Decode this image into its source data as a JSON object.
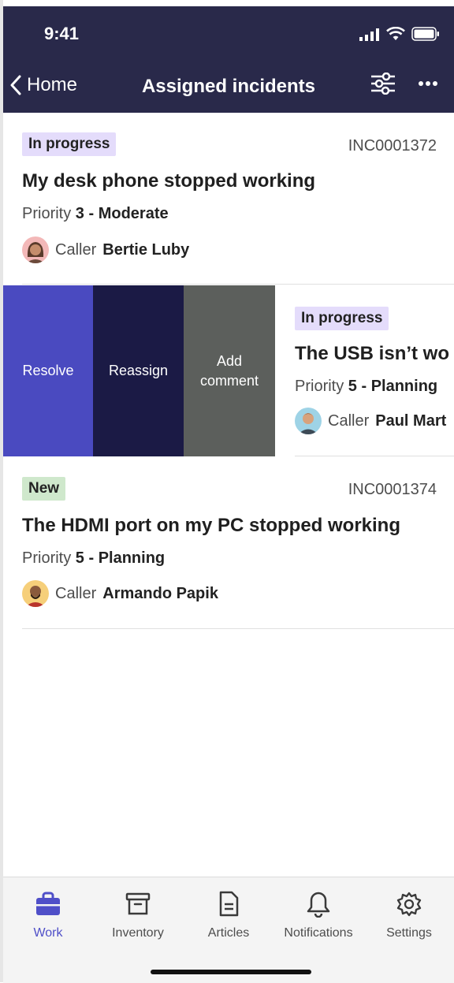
{
  "status_bar": {
    "time": "9:41"
  },
  "nav": {
    "back_label": "Home",
    "title": "Assigned incidents"
  },
  "incidents": [
    {
      "status": "In progress",
      "id": "INC0001372",
      "title": "My desk phone stopped working",
      "priority_label": "Priority",
      "priority_value": "3 - Moderate",
      "caller_label": "Caller",
      "caller_name": "Bertie Luby"
    },
    {
      "status": "In progress",
      "title": "The USB isn’t wo",
      "priority_label": "Priority",
      "priority_value": "5 - Planning",
      "caller_label": "Caller",
      "caller_name": "Paul Mart"
    },
    {
      "status": "New",
      "id": "INC0001374",
      "title": "The HDMI port on my PC stopped working",
      "priority_label": "Priority",
      "priority_value": "5 - Planning",
      "caller_label": "Caller",
      "caller_name": "Armando Papik"
    }
  ],
  "swipe_actions": {
    "resolve": "Resolve",
    "reassign": "Reassign",
    "add_comment_line1": "Add",
    "add_comment_line2": "comment"
  },
  "tabs": [
    {
      "label": "Work",
      "icon": "briefcase-icon",
      "active": true
    },
    {
      "label": "Inventory",
      "icon": "archive-box-icon"
    },
    {
      "label": "Articles",
      "icon": "document-icon"
    },
    {
      "label": "Notifications",
      "icon": "bell-icon"
    },
    {
      "label": "Settings",
      "icon": "gear-icon"
    }
  ],
  "colors": {
    "header_bg": "#29294a",
    "resolve": "#4a4ac0",
    "reassign": "#1b1a45",
    "add_comment": "#5c5f5c",
    "in_progress_badge": "#e4dcfb",
    "new_badge": "#cfe8cc",
    "active_tab": "#4f4fc8"
  }
}
